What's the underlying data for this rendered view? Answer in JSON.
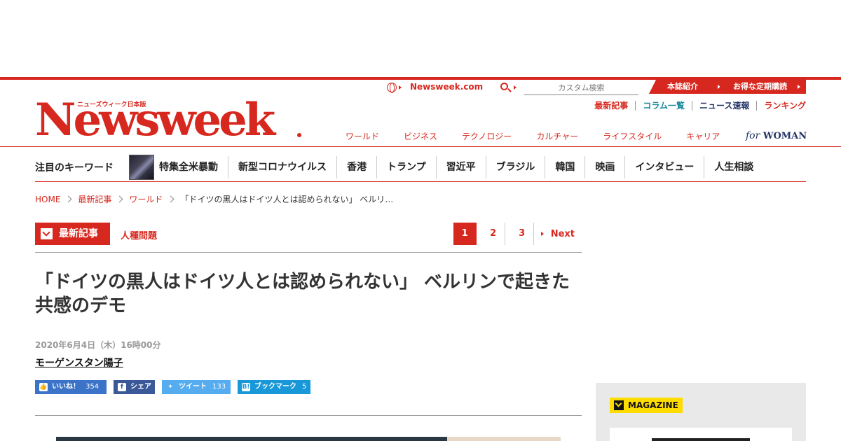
{
  "utility": {
    "site_link": "Newsweek.com",
    "search_placeholder": "カスタム検索",
    "tag_about": "本誌紹介",
    "tag_subscribe": "お得な定期購読"
  },
  "logo": {
    "text": "Newsweek",
    "subtitle": "ニューズウィーク日本版"
  },
  "secondary_links": [
    "最新記事",
    "コラム一覧",
    "ニュース速報",
    "ランキング"
  ],
  "categories": [
    "ワールド",
    "ビジネス",
    "テクノロジー",
    "カルチャー",
    "ライフスタイル",
    "キャリア"
  ],
  "for_woman": {
    "for": "for",
    "woman": "WOMAN"
  },
  "keywords": {
    "title": "注目のキーワード",
    "items": [
      "特集全米暴動",
      "新型コロナウイルス",
      "香港",
      "トランプ",
      "習近平",
      "ブラジル",
      "韓国",
      "映画",
      "インタビュー",
      "人生相談"
    ]
  },
  "breadcrumb": {
    "home": "HOME",
    "latest": "最新記事",
    "world": "ワールド",
    "current": "「ドイツの黒人はドイツ人とは認められない」 ベルリ…"
  },
  "section": {
    "badge": "最新記事",
    "topic": "人種問題",
    "pages": [
      "1",
      "2",
      "3"
    ],
    "next": "Next"
  },
  "article": {
    "headline": "「ドイツの黒人はドイツ人とは認められない」 ベルリンで起きた共感のデモ",
    "date": "2020年6月4日（木）16時00分",
    "author": "モーゲンスタン陽子"
  },
  "share": {
    "like_label": "いいね！",
    "like_count": "354",
    "fb_label": "シェア",
    "tweet_label": "ツイート",
    "tweet_count": "133",
    "hatena_label": "ブックマーク",
    "hatena_count": "5"
  },
  "sidebar": {
    "magazine_label": "MAGAZINE"
  }
}
